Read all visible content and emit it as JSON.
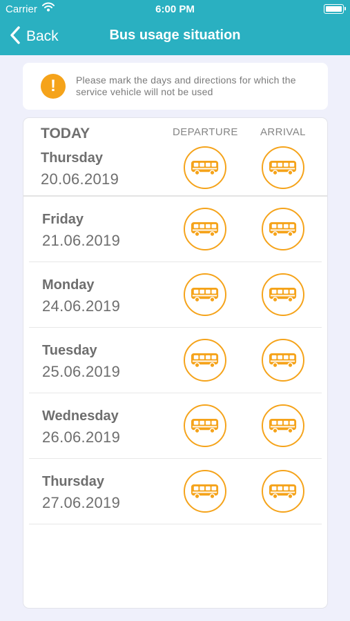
{
  "status": {
    "carrier": "Carrier",
    "time": "6:00 PM"
  },
  "nav": {
    "back_label": "Back",
    "title": "Bus usage situation"
  },
  "notice": {
    "icon": "!",
    "text": "Please mark the days and directions for which the service vehicle will not be used"
  },
  "table": {
    "today_label": "TODAY",
    "departure_label": "DEPARTURE",
    "arrival_label": "ARRIVAL",
    "today": {
      "day": "Thursday",
      "date": "20.06.2019"
    },
    "rows": [
      {
        "day": "Friday",
        "date": "21.06.2019"
      },
      {
        "day": "Monday",
        "date": "24.06.2019"
      },
      {
        "day": "Tuesday",
        "date": "25.06.2019"
      },
      {
        "day": "Wednesday",
        "date": "26.06.2019"
      },
      {
        "day": "Thursday",
        "date": "27.06.2019"
      }
    ]
  },
  "colors": {
    "header": "#2ab0c1",
    "accent": "#f5a31a",
    "background": "#eff0fb"
  },
  "icons": {
    "back": "chevron-left-icon",
    "warning": "warning-icon",
    "bus": "bus-icon"
  }
}
